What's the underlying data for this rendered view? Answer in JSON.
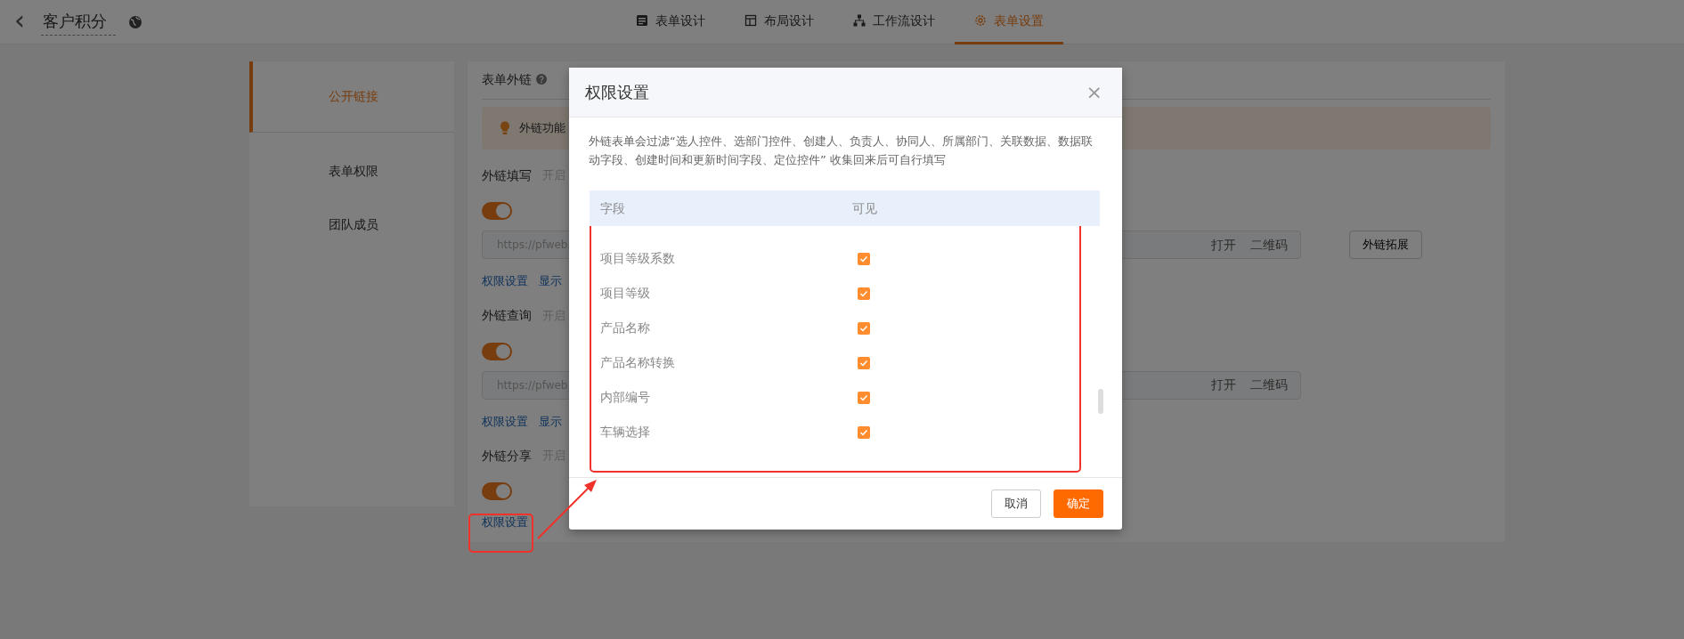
{
  "header": {
    "back": "‹",
    "title": "客户积分",
    "tabs": [
      {
        "label": "表单设计",
        "selected": false
      },
      {
        "label": "布局设计",
        "selected": false
      },
      {
        "label": "工作流设计",
        "selected": false
      },
      {
        "label": "表单设置",
        "selected": true
      }
    ]
  },
  "sidebar": {
    "items": [
      {
        "label": "公开链接",
        "selected": true
      },
      {
        "label": "表单权限",
        "selected": false
      },
      {
        "label": "团队成员",
        "selected": false
      }
    ]
  },
  "panel": {
    "title": "表单外链",
    "alert": "外链功能",
    "sections": [
      {
        "title": "外链填写",
        "hint": "开启",
        "on": true,
        "url": "https://pfweb.",
        "actions": [
          "打开",
          "二维码"
        ],
        "links": [
          "权限设置",
          "显示"
        ],
        "extra_button": "外链拓展"
      },
      {
        "title": "外链查询",
        "hint": "开启",
        "on": true,
        "url": "https://pfweb.",
        "actions": [
          "打开",
          "二维码"
        ],
        "links": [
          "权限设置",
          "显示"
        ]
      },
      {
        "title": "外链分享",
        "hint": "开启",
        "on": true,
        "links": [
          "权限设置"
        ]
      }
    ]
  },
  "dialog": {
    "title": "权限设置",
    "close": "×",
    "description": "外链表单会过滤“选人控件、选部门控件、创建人、负责人、协同人、所属部门、关联数据、数据联动字段、创建时间和更新时间字段、定位控件” 收集回来后可自行填写",
    "columns": [
      "字段",
      "可见"
    ],
    "rows": [
      {
        "field": "项目等级系数",
        "visible": true
      },
      {
        "field": "项目等级",
        "visible": true
      },
      {
        "field": "产品名称",
        "visible": true
      },
      {
        "field": "产品名称转换",
        "visible": true
      },
      {
        "field": "内部编号",
        "visible": true
      },
      {
        "field": "车辆选择",
        "visible": true
      }
    ],
    "buttons": [
      {
        "label": "取消",
        "kind": "secondary"
      },
      {
        "label": "确定",
        "kind": "primary"
      }
    ]
  }
}
